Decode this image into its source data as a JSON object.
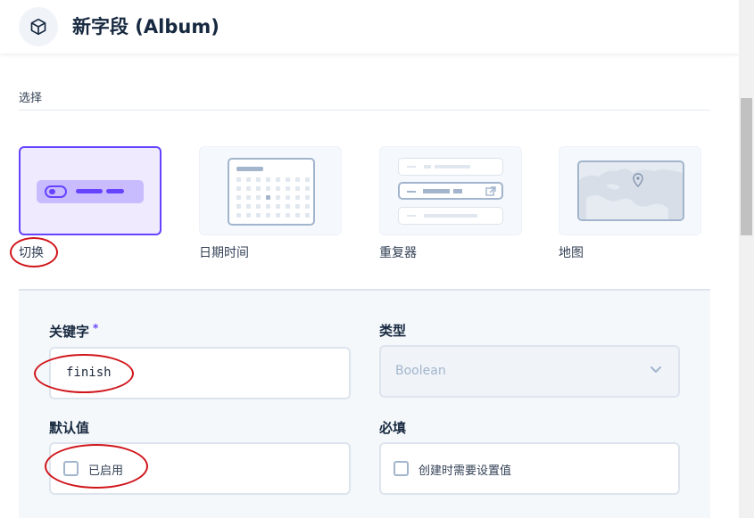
{
  "header": {
    "title": "新字段 (Album)",
    "icon": "box-icon"
  },
  "section": {
    "label": "选择"
  },
  "interfaces": [
    {
      "label": "切换",
      "icon": "toggle-icon",
      "selected": true
    },
    {
      "label": "日期时间",
      "icon": "calendar-icon",
      "selected": false
    },
    {
      "label": "重复器",
      "icon": "repeater-icon",
      "selected": false
    },
    {
      "label": "地图",
      "icon": "map-icon",
      "selected": false
    }
  ],
  "form": {
    "key": {
      "label": "关键字",
      "required_mark": "*",
      "value": "finish"
    },
    "type": {
      "label": "类型",
      "value": "Boolean"
    },
    "default": {
      "label": "默认值",
      "checkbox_label": "已启用"
    },
    "required": {
      "label": "必填",
      "checkbox_label": "创建时需要设置值"
    }
  },
  "colors": {
    "accent": "#6644ff",
    "annotation": "#d0161b"
  }
}
